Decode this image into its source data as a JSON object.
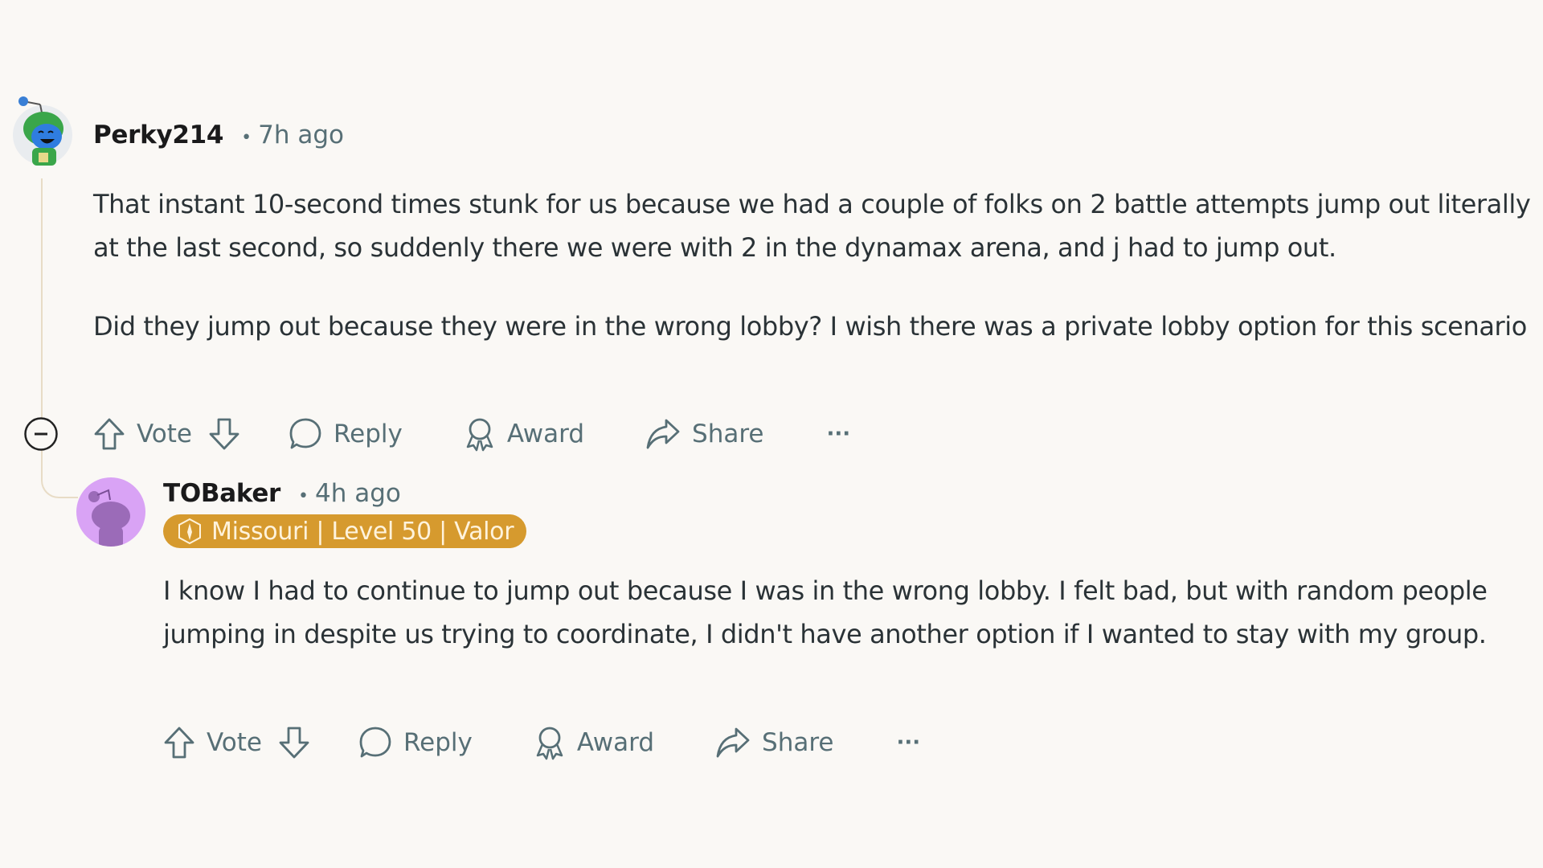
{
  "comments": [
    {
      "username": "Perky214",
      "separator": "•",
      "time_ago": "7h ago",
      "avatar": "snoo-avatar-green-hood-icon",
      "paragraphs": [
        "That instant 10-second times stunk for us because we had a couple of folks on 2 battle attempts jump out literally at the last second, so suddenly there we were with 2 in the dynamax arena, and j had to jump out.",
        "Did they jump out because they were in the wrong lobby? I wish there was a private lobby option for this scenario"
      ],
      "actions": {
        "vote_label": "Vote",
        "reply_label": "Reply",
        "award_label": "Award",
        "share_label": "Share",
        "more_label": "···"
      }
    },
    {
      "username": "TOBaker",
      "separator": "•",
      "time_ago": "4h ago",
      "avatar": "snoo-avatar-purple-icon",
      "flair": {
        "text": "Missouri | Level 50 | Valor",
        "icon": "valor-team-icon",
        "background": "#d69a2e"
      },
      "paragraphs": [
        "I know I had to continue to jump out because I was in the wrong lobby. I felt bad, but with random people jumping in despite us trying to coordinate, I didn't have another option if I wanted to stay with my group."
      ],
      "actions": {
        "vote_label": "Vote",
        "reply_label": "Reply",
        "award_label": "Award",
        "share_label": "Share",
        "more_label": "···"
      }
    }
  ],
  "colors": {
    "background": "#faf8f5",
    "thread_line": "#e8dcc6",
    "meta_text": "#576f76",
    "body_text": "#2a3236"
  }
}
